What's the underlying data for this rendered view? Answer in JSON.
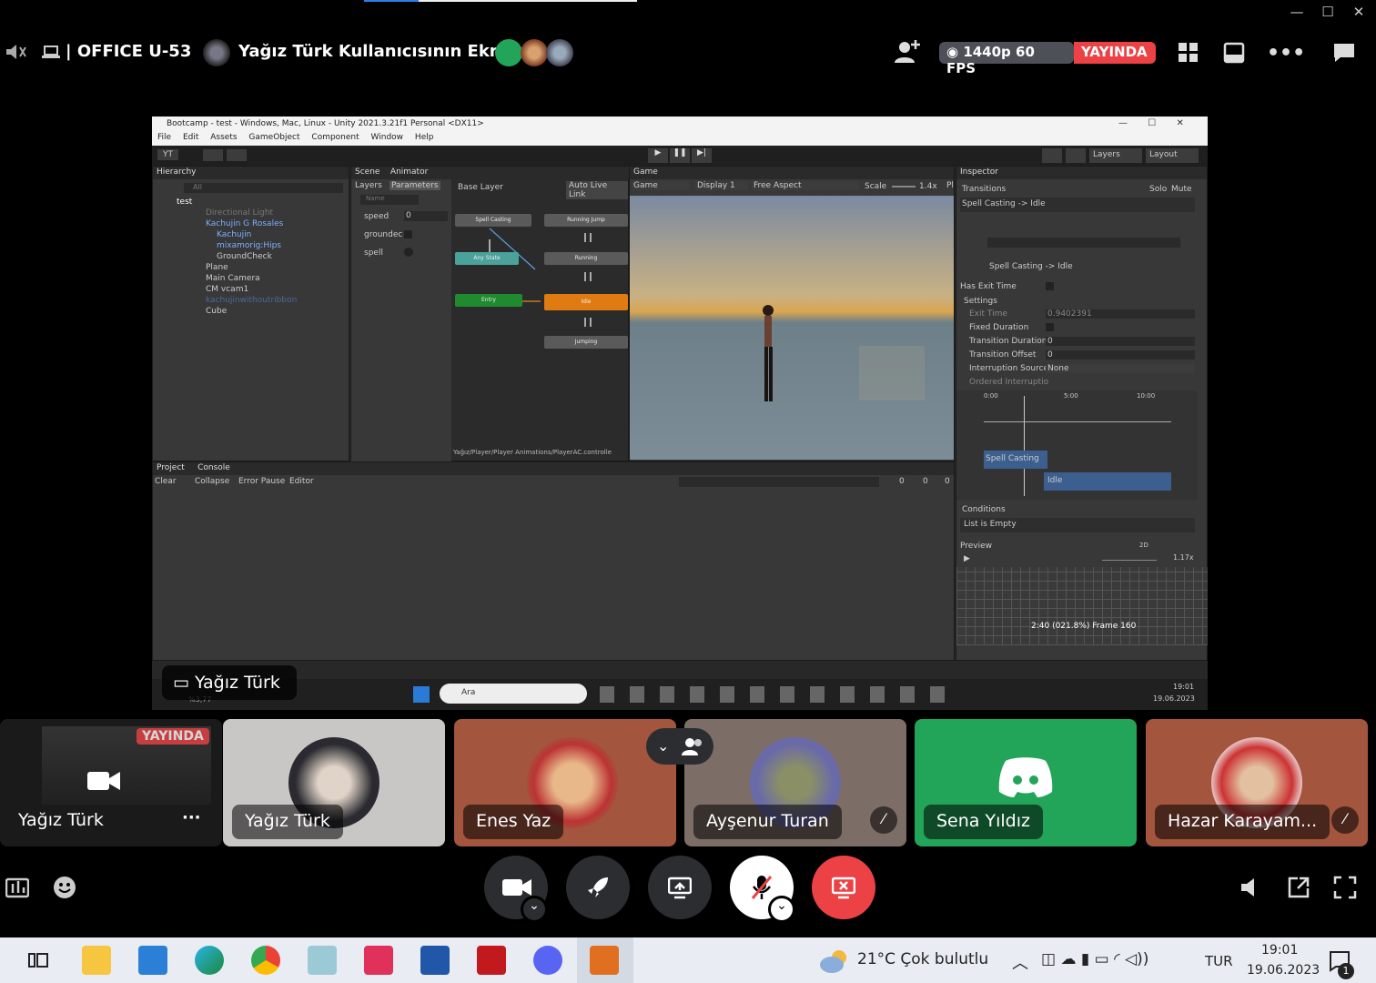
{
  "window": {
    "minimize": "—",
    "maximize": "☐",
    "close": "✕"
  },
  "topbar": {
    "server": "| OFFICE U-53",
    "title": "Yağız Türk Kullanıcısının Ekranı",
    "quality": "1440p 60 FPS",
    "live": "YAYINDA"
  },
  "unity": {
    "title": "Bootcamp - test - Windows, Mac, Linux - Unity 2021.3.21f1 Personal <DX11>",
    "menu": [
      "File",
      "Edit",
      "Assets",
      "GameObject",
      "Component",
      "Window",
      "Help"
    ],
    "account": "YT",
    "layers": "Layers",
    "layout": "Layout",
    "hierarchy": {
      "tab": "Hierarchy",
      "search": "All",
      "items": [
        "test",
        "Directional Light",
        "Kachujin G Rosales",
        "Kachujin",
        "mixamorig:Hips",
        "GroundCheck",
        "Plane",
        "Main Camera",
        "CM vcam1",
        "kachujinwithoutribbon",
        "Cube"
      ]
    },
    "tabs": {
      "scene": "Scene",
      "animator": "Animator",
      "game": "Game",
      "inspector": "Inspector",
      "project": "Project",
      "console": "Console"
    },
    "animator": {
      "layers": "Layers",
      "parameters": "Parameters",
      "base_layer": "Base Layer",
      "auto_live": "Auto Live Link",
      "name_ph": "Name",
      "params": [
        "speed",
        "groundec",
        "spell"
      ],
      "speed_value": "0",
      "nodes": {
        "spell": "Spell Casting",
        "runjump": "Running Jump",
        "any": "Any State",
        "running": "Running",
        "entry": "Entry",
        "idle": "Idle",
        "jumping": "Jumping"
      },
      "path": "Yağız/Player/Player Animations/PlayerAC.controlle"
    },
    "game": {
      "mode": "Game",
      "display": "Display 1",
      "aspect": "Free Aspect",
      "scale_label": "Scale",
      "scale": "1.4x",
      "pl": "Pl"
    },
    "inspector": {
      "transitions": "Transitions",
      "solo": "Solo",
      "mute": "Mute",
      "transition": "Spell Casting -> Idle",
      "transition2": "Spell Casting -> Idle",
      "has_exit": "Has Exit Time",
      "settings": "Settings",
      "exit_time_l": "Exit Time",
      "exit_time": "0.9402391",
      "fixed": "Fixed Duration",
      "tdur_l": "Transition Duration",
      "tdur": "0",
      "toff_l": "Transition Offset",
      "toff": "0",
      "isrc_l": "Interruption Source",
      "isrc": "None",
      "ordered": "Ordered Interruptio",
      "t0": "0:00",
      "t5": "5:00",
      "t10": "10:00",
      "bar1": "Spell Casting",
      "bar2": "Idle",
      "conditions": "Conditions",
      "empty": "List is Empty",
      "preview": "Preview",
      "twod": "2D",
      "speed": "1.17x",
      "frame": "2:40 (021.8%) Frame 160"
    },
    "console": {
      "clear": "Clear",
      "collapse": "Collapse",
      "error_pause": "Error Pause",
      "editor": "Editor",
      "c1": "0",
      "c2": "0",
      "c3": "0"
    },
    "win_taskbar": {
      "search": "Ara",
      "time": "19:01",
      "date": "19.06.2023"
    },
    "stream_label": "Yağız Türk",
    "corner_small": "%3,77"
  },
  "participants": [
    {
      "name": "Yağız Türk",
      "live": "YAYINDA"
    },
    {
      "name": "Yağız Türk"
    },
    {
      "name": "Enes Yaz"
    },
    {
      "name": "Ayşenur Turan"
    },
    {
      "name": "Sena Yıldız"
    },
    {
      "name": "Hazar Karayam..."
    }
  ],
  "taskbar": {
    "weather": "21°C  Çok bulutlu",
    "lang": "TUR",
    "time": "19:01",
    "date": "19.06.2023",
    "notif": "1"
  },
  "colors": {
    "live": "#ed4245",
    "discord": "#5865f2",
    "green_tile": "#23a559",
    "hangup": "#ed4245"
  }
}
